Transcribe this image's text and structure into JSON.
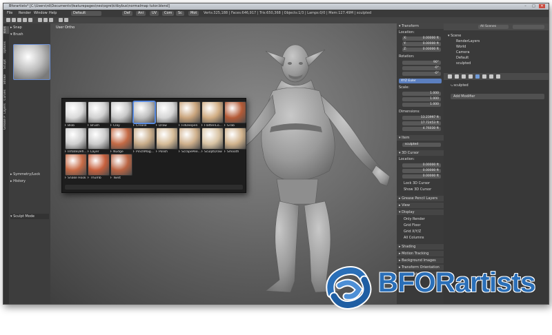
{
  "window": {
    "title": "Bforartists* [C:\\Users\\rd\\Documents\\featurepages\\neo\\ogre\\kitbybus\\normalmap tutor.blend]",
    "min": "–",
    "max": "□",
    "close": "✕"
  },
  "menubar": {
    "items": [
      "File",
      "Render",
      "Window",
      "Help"
    ],
    "layout": "Default",
    "editors": [
      "Def",
      "Ani",
      "UV",
      "Com",
      "Sc",
      "Mot"
    ],
    "stats": "Verts:325,188 | Faces:646,917 | Tris:650,368 | Objects:1/3 | Lamps:0/0 | Mem:127.49M | sculpted"
  },
  "lefttabs": [
    "Tools",
    "Options",
    "Sculpt",
    "Stroke",
    "Curves",
    "Layers",
    "Grease P"
  ],
  "toolshelf": {
    "snap": "Snap",
    "brush": "Brush",
    "symmetry": "Symmetry/Lock",
    "history": "History",
    "mode": "Sculpt Mode"
  },
  "viewport": {
    "label": "User Ortho"
  },
  "brushes": [
    {
      "label": "F Blob",
      "color": "#d9d9d9"
    },
    {
      "label": "F Brush",
      "color": "#d0d0d0"
    },
    {
      "label": "F Clay",
      "color": "#c8c8c8"
    },
    {
      "label": "F Crease",
      "color": "#bfbfbf",
      "selected": true
    },
    {
      "label": "F Draw",
      "color": "#d4d4d4"
    },
    {
      "label": "F FillDeepen",
      "color": "#c9a47c"
    },
    {
      "label": "F FlattenCo...",
      "color": "#d1ad83"
    },
    {
      "label": "F Grab",
      "color": "#b45b37"
    },
    {
      "label": "F InflateDefl...",
      "color": "#cfcfcf"
    },
    {
      "label": "F Layer",
      "color": "#cccccc"
    },
    {
      "label": "F Nudge",
      "color": "#c46a45"
    },
    {
      "label": "F PinchMag...",
      "color": "#c9ad8a"
    },
    {
      "label": "F Polish",
      "color": "#d6bc98"
    },
    {
      "label": "F ScrapePee...",
      "color": "#cfb08c"
    },
    {
      "label": "F SculptDraw",
      "color": "#d8c3a3"
    },
    {
      "label": "F Smooth",
      "color": "#d1b38d"
    },
    {
      "label": "F Snake Hook",
      "color": "#c76b46"
    },
    {
      "label": "F Thumb",
      "color": "#c7603d"
    },
    {
      "label": "F Twist",
      "color": "#ba6443"
    }
  ],
  "npanel": {
    "transform": "Transform",
    "location": "Location:",
    "loc": [
      "X:",
      "Y:",
      "Z:"
    ],
    "loc_vals": [
      "0.00000 ft",
      "0.00000 ft",
      "0.00000 ft"
    ],
    "rotation": "Rotation:",
    "rot_vals": [
      "90°",
      "-0°",
      "-0°"
    ],
    "rot_mode": "XYZ Euler",
    "scale": "Scale:",
    "scale_vals": [
      "1.000",
      "1.000",
      "1.000"
    ],
    "dimensions": "Dimensions:",
    "dim_vals": [
      "13.23997 ft",
      "17.72453 ft",
      "4.76030 ft"
    ],
    "item": "Item",
    "item_name": "sculpted",
    "cursor": "3D Cursor",
    "cursor_location": "Location:",
    "cursor_vals": [
      "0.00000 ft",
      "0.00000 ft",
      "0.00000 ft"
    ],
    "lock_cursor": "Lock 3D Cursor",
    "show_cursor": "Show 3D Cursor",
    "grease_pencil": "Grease Pencil Layers",
    "view": "View",
    "display": "Display",
    "only_render": "Only Render",
    "grid_floor": "Grid Floor",
    "grid_xyz": "Grid X/Y/Z",
    "all_columns": "All Columns",
    "shading": "Shading",
    "motion_tracking": "Motion Tracking",
    "bg_images": "Background Images",
    "transform_orient": "Transform Orientation",
    "snap_select": "Snap Select"
  },
  "outliner": {
    "filter": "All Scenes",
    "search": "",
    "rows": [
      "Scene",
      "RenderLayers",
      "World",
      "Camera",
      "Default",
      "sculpted"
    ]
  },
  "properties": {
    "object": "sculpted",
    "add_modifier": "Add Modifier"
  },
  "logo": {
    "text": "BFORartists",
    "blue": "#2a6fb8"
  }
}
